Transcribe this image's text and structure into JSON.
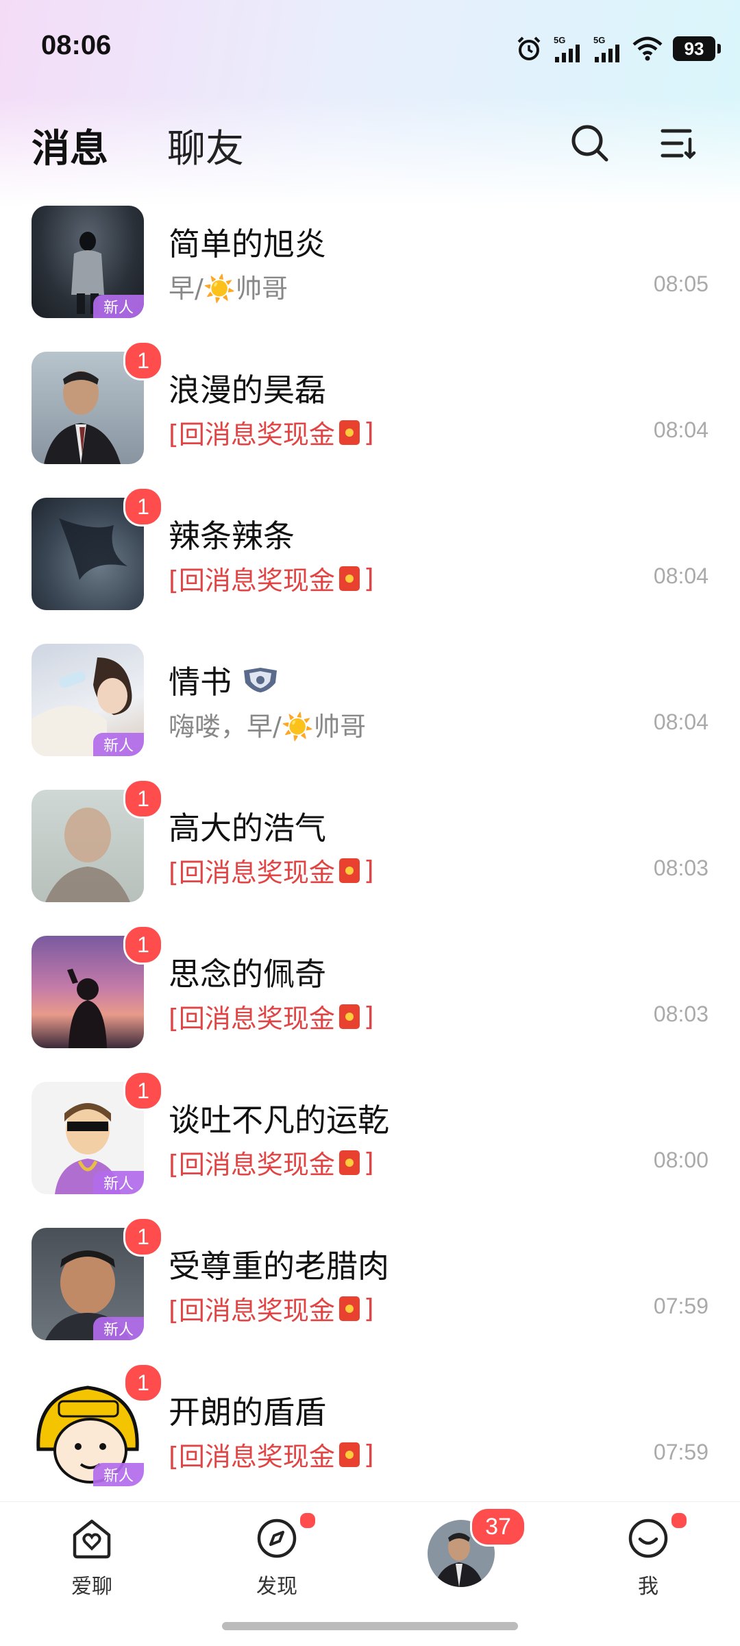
{
  "status": {
    "time": "08:06",
    "signal1": "5G",
    "signal2": "5G",
    "battery": "93"
  },
  "header": {
    "tab_messages": "消息",
    "tab_friends": "聊友"
  },
  "tags": {
    "new": "新人"
  },
  "conversations": [
    {
      "name": "简单的旭炎",
      "preview": "早/☀️帅哥",
      "time": "08:05",
      "badge": "",
      "is_new": true,
      "reward": false
    },
    {
      "name": "浪漫的昊磊",
      "preview": "[回消息奖现金",
      "preview_end": "]",
      "time": "08:04",
      "badge": "1",
      "is_new": false,
      "reward": true
    },
    {
      "name": "辣条辣条",
      "preview": "[回消息奖现金",
      "preview_end": "]",
      "time": "08:04",
      "badge": "1",
      "is_new": false,
      "reward": true
    },
    {
      "name": "情书",
      "preview": "嗨喽，早/☀️帅哥",
      "time": "08:04",
      "badge": "",
      "is_new": true,
      "reward": false
    },
    {
      "name": "高大的浩气",
      "preview": "[回消息奖现金",
      "preview_end": "]",
      "time": "08:03",
      "badge": "1",
      "is_new": false,
      "reward": true
    },
    {
      "name": "思念的佩奇",
      "preview": "[回消息奖现金",
      "preview_end": "]",
      "time": "08:03",
      "badge": "1",
      "is_new": false,
      "reward": true
    },
    {
      "name": "谈吐不凡的运乾",
      "preview": "[回消息奖现金",
      "preview_end": "]",
      "time": "08:00",
      "badge": "1",
      "is_new": true,
      "reward": true
    },
    {
      "name": "受尊重的老腊肉",
      "preview": "[回消息奖现金",
      "preview_end": "]",
      "time": "07:59",
      "badge": "1",
      "is_new": true,
      "reward": true
    },
    {
      "name": "开朗的盾盾",
      "preview": "[回消息奖现金",
      "preview_end": "]",
      "time": "07:59",
      "badge": "1",
      "is_new": true,
      "reward": true
    }
  ],
  "tabbar": {
    "home_label": "爱聊",
    "discover_label": "发现",
    "center_badge": "37",
    "me_label": "我"
  },
  "colors": {
    "accent_red": "#e04444",
    "badge_red": "#ff4d4d",
    "new_tag_purple": "#b26beb"
  }
}
